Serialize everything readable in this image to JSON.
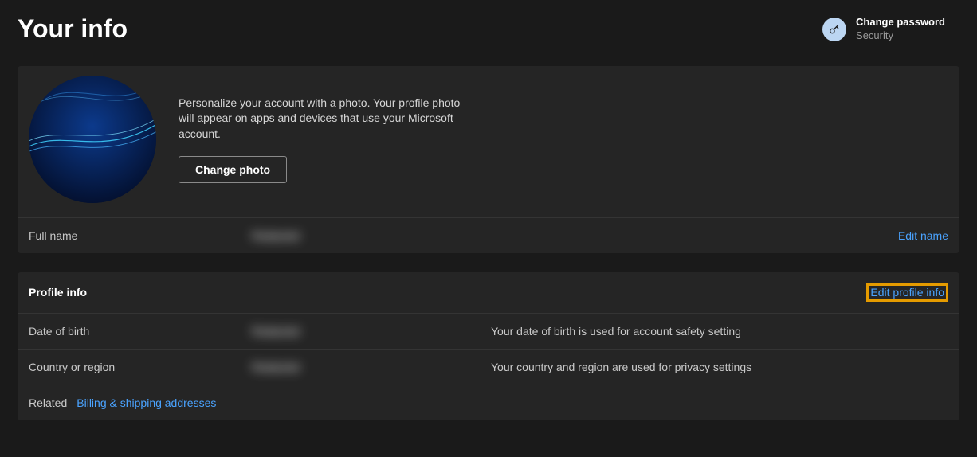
{
  "header": {
    "title": "Your info",
    "action": {
      "primary": "Change password",
      "secondary": "Security"
    }
  },
  "photo_card": {
    "description": "Personalize your account with a photo. Your profile photo will appear on apps and devices that use your Microsoft account.",
    "button": "Change photo"
  },
  "full_name_row": {
    "label": "Full name",
    "value": "Redacted",
    "action": "Edit name"
  },
  "profile_section": {
    "title": "Profile info",
    "action": "Edit profile info",
    "rows": {
      "dob": {
        "label": "Date of birth",
        "value": "Redacted",
        "help": "Your date of birth is used for account safety setting"
      },
      "country": {
        "label": "Country or region",
        "value": "Redacted",
        "help": "Your country and region are used for privacy settings"
      }
    },
    "related_label": "Related",
    "related_link": "Billing & shipping addresses"
  }
}
